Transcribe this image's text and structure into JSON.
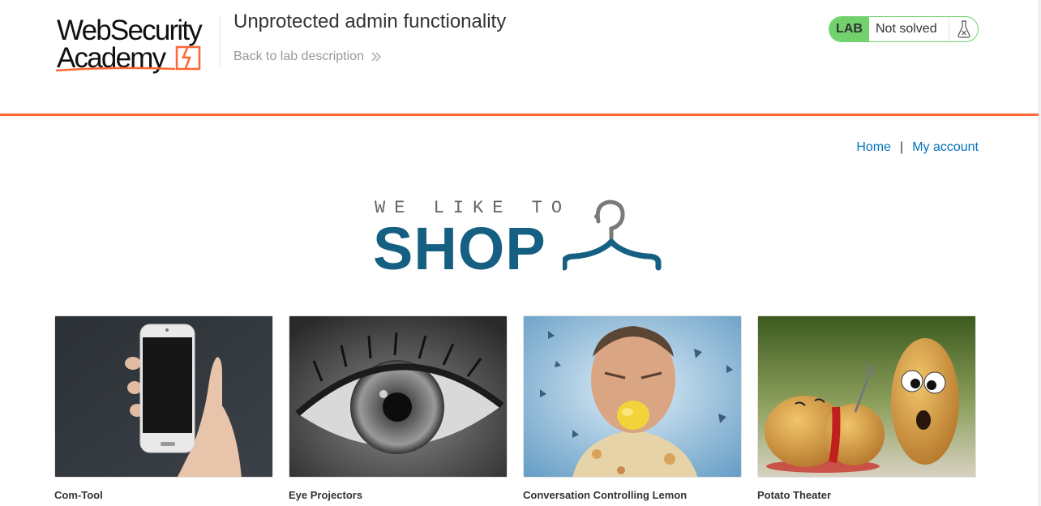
{
  "academy": {
    "logo_line1": "WebSecurity",
    "logo_line2": "Academy",
    "lab_title": "Unprotected admin functionality",
    "back_link": "Back to lab description",
    "back_icon": "double-chevron-right-icon",
    "lab_badge": "LAB",
    "lab_status": "Not solved",
    "status_icon": "flask-icon"
  },
  "nav": {
    "home": "Home",
    "separator": "|",
    "account": "My account"
  },
  "banner": {
    "small_text": "WE LIKE TO",
    "big_text": "SHOP",
    "icon": "hanger-icon"
  },
  "products": [
    {
      "name": "Com-Tool"
    },
    {
      "name": "Eye Projectors"
    },
    {
      "name": "Conversation Controlling Lemon"
    },
    {
      "name": "Potato Theater"
    }
  ],
  "colors": {
    "accent": "#ff6633",
    "link": "#0071bc",
    "lab_green": "#70d16d",
    "banner_blue": "#155f82"
  }
}
